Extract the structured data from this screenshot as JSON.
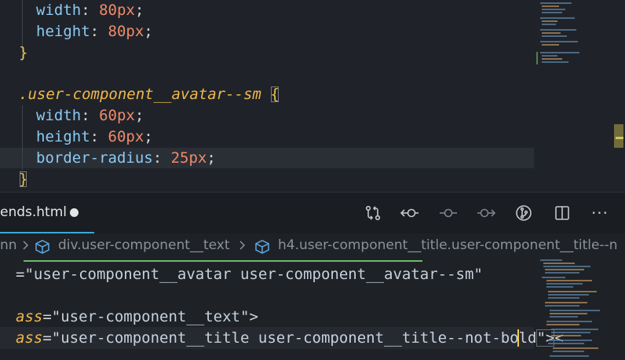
{
  "css_editor": {
    "lines": {
      "l1_prop": "width",
      "l1_val": "80px",
      "l2_prop": "height",
      "l2_val": "80px",
      "l3_brace": "}",
      "l5_dot": ".",
      "l5_selector": "user-component__avatar--sm",
      "l5_open": "{",
      "l6_prop": "width",
      "l6_val": "60px",
      "l7_prop": "height",
      "l7_val": "60px",
      "l8_prop": "border-radius",
      "l8_val": "25px",
      "l9_brace": "}"
    }
  },
  "tab": {
    "filename": "ends.html",
    "dirty_indicator": "modified-dot"
  },
  "toolbar": {
    "icons": [
      "source-control-compare-icon",
      "go-back-icon",
      "timeline-icon",
      "go-forward-icon",
      "git-lens-icon",
      "split-editor-icon",
      "more-actions-icon"
    ],
    "more_label": "···"
  },
  "breadcrumb": {
    "seg1": "nn",
    "seg2": "div.user-component__text",
    "seg3": "h4.user-component__title.user-component__title--n"
  },
  "html_editor": {
    "l1_q1": "=\"",
    "l1_str": "user-component__avatar user-component__avatar--sm",
    "l1_q2": "\"",
    "l3_attr": "ass",
    "l3_eq": "=\"",
    "l3_str": "user-component__text",
    "l3_end": "\">",
    "l4_attr": "ass",
    "l4_eq": "=\"",
    "l4_str": "user-component__title user-component__title--not-bold",
    "l4_end": "\">",
    "l4_tail": "<"
  },
  "colors": {
    "background": "#1e2227",
    "accent_tab_underline": "#3ba8d8",
    "property": "#8cc9f3",
    "number": "#f08a6a",
    "selector": "#f2b84b"
  }
}
